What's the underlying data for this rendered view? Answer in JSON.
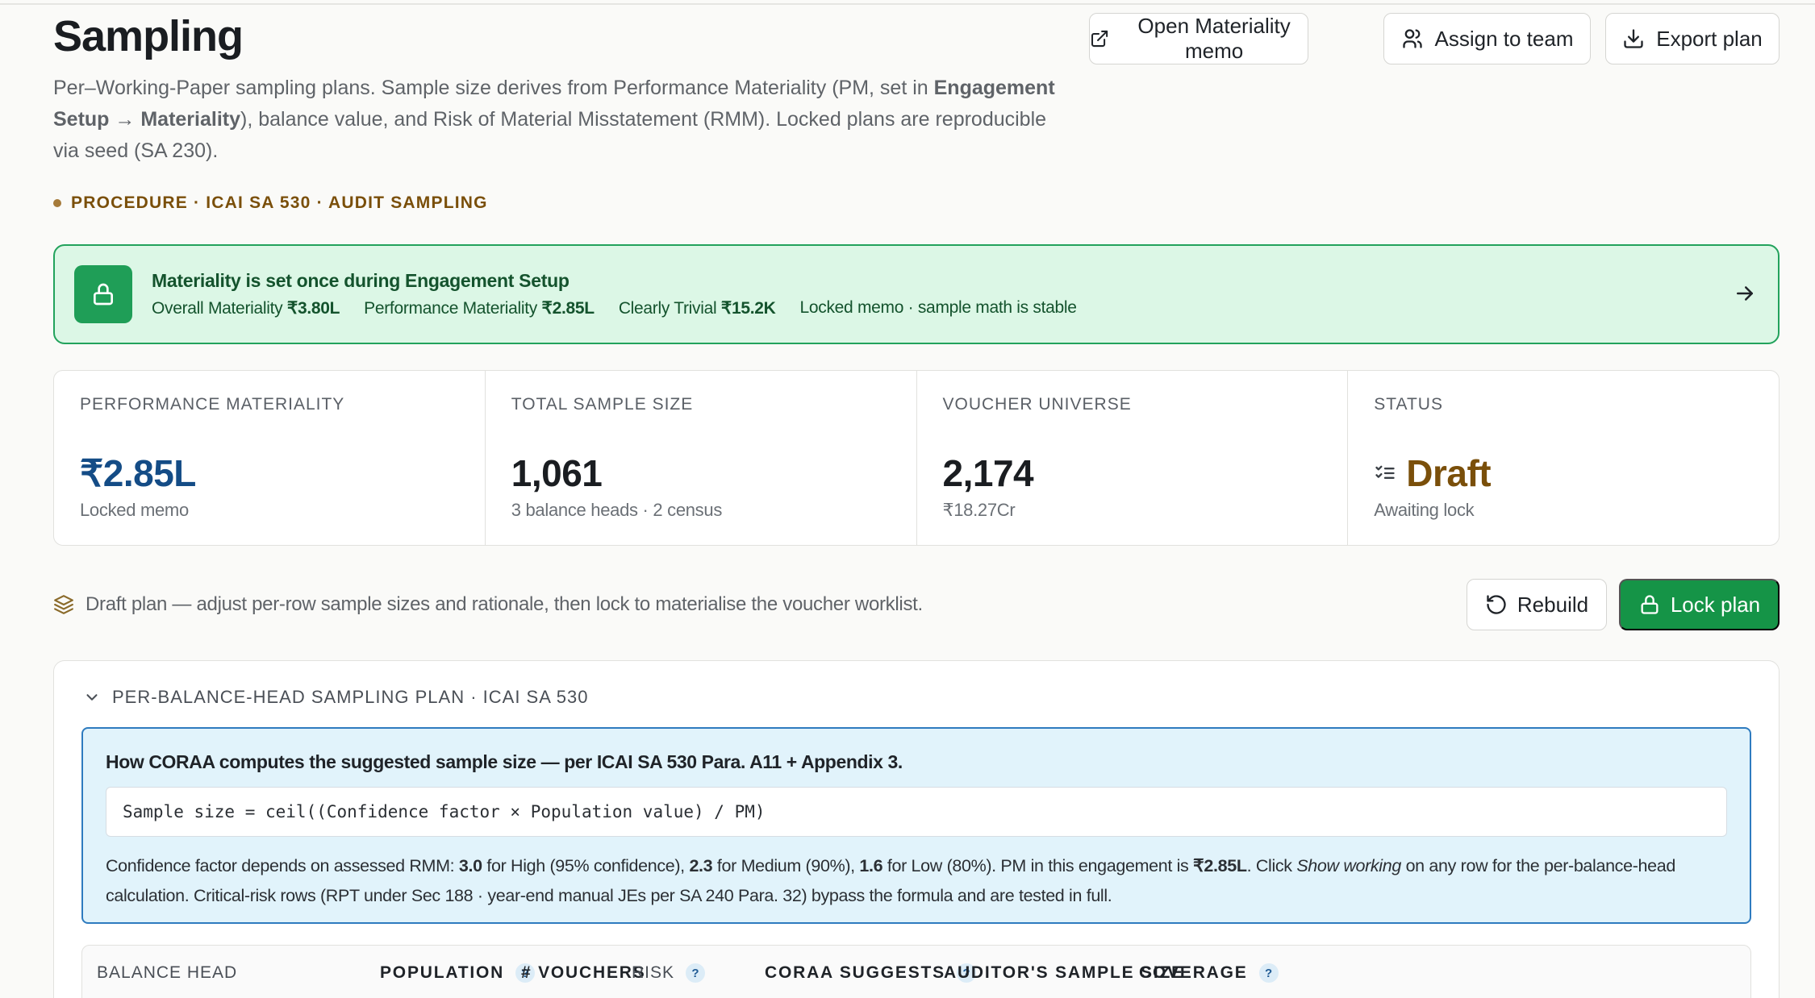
{
  "header": {
    "title": "Sampling",
    "subtitle_p1": "Per–Working-Paper sampling plans. Sample size derives from Performance Materiality (PM, set in ",
    "subtitle_b1": "Engagement Setup → Materiality",
    "subtitle_p2": "), balance value, and Risk of Material Misstatement (RMM). Locked plans are reproducible via seed (SA 230).",
    "procedure": "PROCEDURE · ICAI SA 530 · AUDIT SAMPLING",
    "buttons": {
      "memo": "Open Materiality memo",
      "assign": "Assign to team",
      "export": "Export plan"
    }
  },
  "banner": {
    "title": "Materiality is set once during Engagement Setup",
    "overall_label": "Overall Materiality",
    "overall_value": "₹3.80L",
    "pm_label": "Performance Materiality",
    "pm_value": "₹2.85L",
    "ct_label": "Clearly Trivial",
    "ct_value": "₹15.2K",
    "note": "Locked memo · sample math is stable"
  },
  "stats": [
    {
      "label": "PERFORMANCE MATERIALITY",
      "value": "₹2.85L",
      "sub": "Locked memo"
    },
    {
      "label": "TOTAL SAMPLE SIZE",
      "value": "1,061",
      "sub": "3 balance heads · 2 census"
    },
    {
      "label": "VOUCHER UNIVERSE",
      "value": "2,174",
      "sub": "₹18.27Cr"
    },
    {
      "label": "STATUS",
      "value": "Draft",
      "sub": "Awaiting lock"
    }
  ],
  "draft_row": {
    "text": "Draft plan — adjust per-row sample sizes and rationale, then lock to materialise the voucher worklist.",
    "rebuild": "Rebuild",
    "lock": "Lock plan"
  },
  "plan": {
    "heading": "PER-BALANCE-HEAD SAMPLING PLAN · ICAI SA 530",
    "info_title": "How CORAA computes the suggested sample size — per ICAI SA 530 Para. A11 + Appendix 3.",
    "formula": "Sample size = ceil((Confidence factor × Population value) / PM)",
    "body": {
      "t1": "Confidence factor depends on assessed RMM: ",
      "b1": "3.0",
      "t2": " for High (95% confidence), ",
      "b2": "2.3",
      "t3": " for Medium (90%), ",
      "b3": "1.6",
      "t4": " for Low (80%). PM in this engagement is ",
      "b4": "₹2.85L",
      "t5": ". Click ",
      "i1": "Show working",
      "t6": " on any row for the per-balance-head calculation. Critical-risk rows (RPT under Sec 188 · year-end manual JEs per SA 240 Para. 32) bypass the formula and are tested in full."
    },
    "columns": [
      "BALANCE HEAD",
      "POPULATION",
      "# VOUCHERS",
      "RISK",
      "CORAA SUGGESTS",
      "AUDITOR'S SAMPLE SIZE",
      "COVERAGE"
    ],
    "help_glyph": "?"
  }
}
